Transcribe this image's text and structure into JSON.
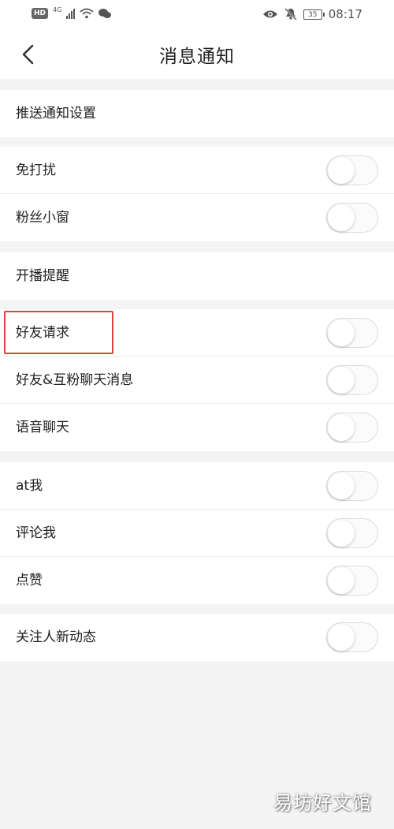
{
  "status_bar": {
    "hd": "HD",
    "network": "4G",
    "battery": "35",
    "time": "08:17"
  },
  "header": {
    "title": "消息通知"
  },
  "groups": [
    {
      "items": [
        {
          "label": "推送通知设置",
          "has_toggle": false
        }
      ]
    },
    {
      "items": [
        {
          "label": "免打扰",
          "has_toggle": true,
          "on": false
        },
        {
          "label": "粉丝小窗",
          "has_toggle": true,
          "on": false
        }
      ]
    },
    {
      "items": [
        {
          "label": "开播提醒",
          "has_toggle": false
        }
      ]
    },
    {
      "items": [
        {
          "label": "好友请求",
          "has_toggle": true,
          "on": false
        },
        {
          "label": "好友&互粉聊天消息",
          "has_toggle": true,
          "on": false
        },
        {
          "label": "语音聊天",
          "has_toggle": true,
          "on": false
        }
      ]
    },
    {
      "items": [
        {
          "label": "at我",
          "has_toggle": true,
          "on": false
        },
        {
          "label": "评论我",
          "has_toggle": true,
          "on": false
        },
        {
          "label": "点赞",
          "has_toggle": true,
          "on": false
        }
      ]
    },
    {
      "items": [
        {
          "label": "关注人新动态",
          "has_toggle": true,
          "on": false
        }
      ]
    }
  ],
  "watermark": "易坊好文馆",
  "colors": {
    "background": "#f4f4f4",
    "highlight_border": "#d9463e"
  }
}
